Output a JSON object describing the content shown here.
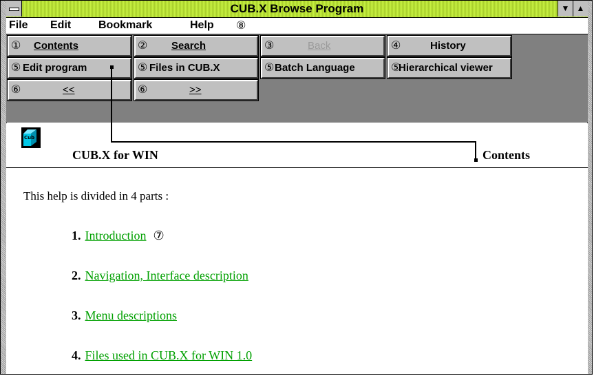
{
  "window": {
    "title": "CUB.X Browse Program"
  },
  "menu": [
    {
      "label": "File"
    },
    {
      "label": "Edit"
    },
    {
      "label": "Bookmark"
    },
    {
      "label": "Help"
    },
    {
      "label": "⑧"
    }
  ],
  "toolbar": {
    "row1": [
      {
        "num": "①",
        "label": "Contents"
      },
      {
        "num": "②",
        "label": "Search"
      },
      {
        "num": "③",
        "label": "Back",
        "disabled": true
      },
      {
        "num": "④",
        "label": "History"
      }
    ],
    "row2": [
      {
        "num": "⑤",
        "label": "Edit program"
      },
      {
        "num": "⑤",
        "label": "Files in CUB.X"
      },
      {
        "num": "⑤",
        "label": "Batch Language"
      },
      {
        "num": "⑤",
        "label": "Hierarchical viewer"
      }
    ],
    "row3": [
      {
        "num": "⑥",
        "label": "<<"
      },
      {
        "num": "⑥",
        "label": ">>"
      }
    ]
  },
  "header": {
    "logo_text": "Cub X",
    "title": "CUB.X for WIN",
    "callout": "Contents"
  },
  "content": {
    "intro": "This help is divided in 4 parts :",
    "items": [
      {
        "num": "1.",
        "label": "Introduction",
        "badge": "⑦"
      },
      {
        "num": "2.",
        "label": "Navigation, Interface description"
      },
      {
        "num": "3.",
        "label": "Menu descriptions"
      },
      {
        "num": "4.",
        "label": "Files used in CUB.X for WIN 1.0"
      }
    ]
  },
  "colors": {
    "title_bar": "#b8e336",
    "link": "#00a000",
    "toolbar_bg": "#808080",
    "button_face": "#c0c0c0"
  }
}
